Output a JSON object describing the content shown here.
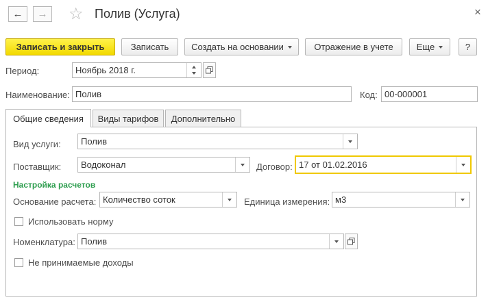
{
  "window": {
    "title": "Полив (Услуга)",
    "close_glyph": "×"
  },
  "nav": {
    "back_glyph": "←",
    "forward_glyph": "→",
    "star_glyph": "☆"
  },
  "toolbar": {
    "save_close": "Записать и закрыть",
    "save": "Записать",
    "create_based": "Создать на основании",
    "accounting": "Отражение в учете",
    "more": "Еще",
    "help": "?"
  },
  "header": {
    "period_label": "Период:",
    "period_value": "Ноябрь 2018 г.",
    "name_label": "Наименование:",
    "name_value": "Полив",
    "code_label": "Код:",
    "code_value": "00-000001"
  },
  "tabs": [
    {
      "label": "Общие сведения"
    },
    {
      "label": "Виды тарифов"
    },
    {
      "label": "Дополнительно"
    }
  ],
  "general": {
    "service_type_label": "Вид услуги:",
    "service_type_value": "Полив",
    "supplier_label": "Поставщик:",
    "supplier_value": "Водоконал",
    "contract_label": "Договор:",
    "contract_value": "17 от 01.02.2016",
    "calc_section": "Настройка расчетов",
    "calc_basis_label": "Основание расчета:",
    "calc_basis_value": "Количество соток",
    "unit_label": "Единица измерения:",
    "unit_value": "м3",
    "use_norm_label": "Использовать норму",
    "nomenclature_label": "Номенклатура:",
    "nomenclature_value": "Полив",
    "non_accepted_income_label": "Не принимаемые доходы"
  }
}
